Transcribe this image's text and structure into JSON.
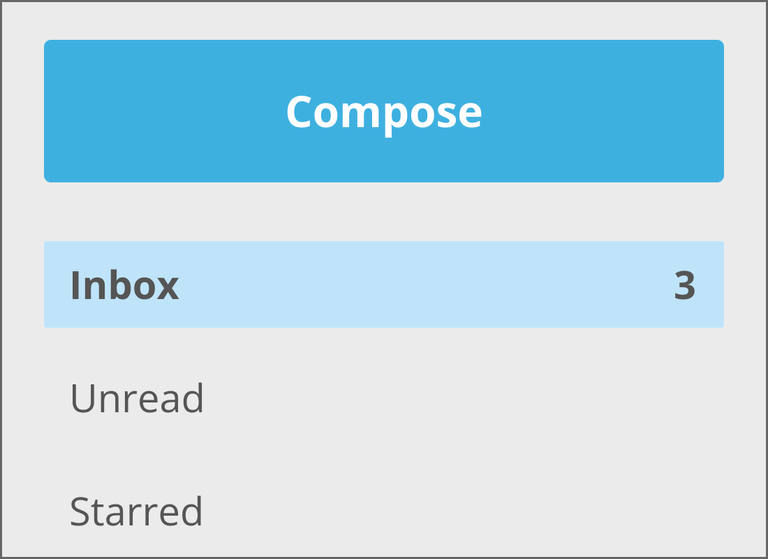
{
  "sidebar": {
    "compose_label": "Compose",
    "folders": [
      {
        "label": "Inbox",
        "count": "3",
        "active": true
      },
      {
        "label": "Unread",
        "count": "",
        "active": false
      },
      {
        "label": "Starred",
        "count": "",
        "active": false
      }
    ]
  },
  "colors": {
    "compose_bg": "#3eb0e0",
    "active_bg": "#bfe4f9",
    "panel_bg": "#ebebeb",
    "text": "#555"
  }
}
